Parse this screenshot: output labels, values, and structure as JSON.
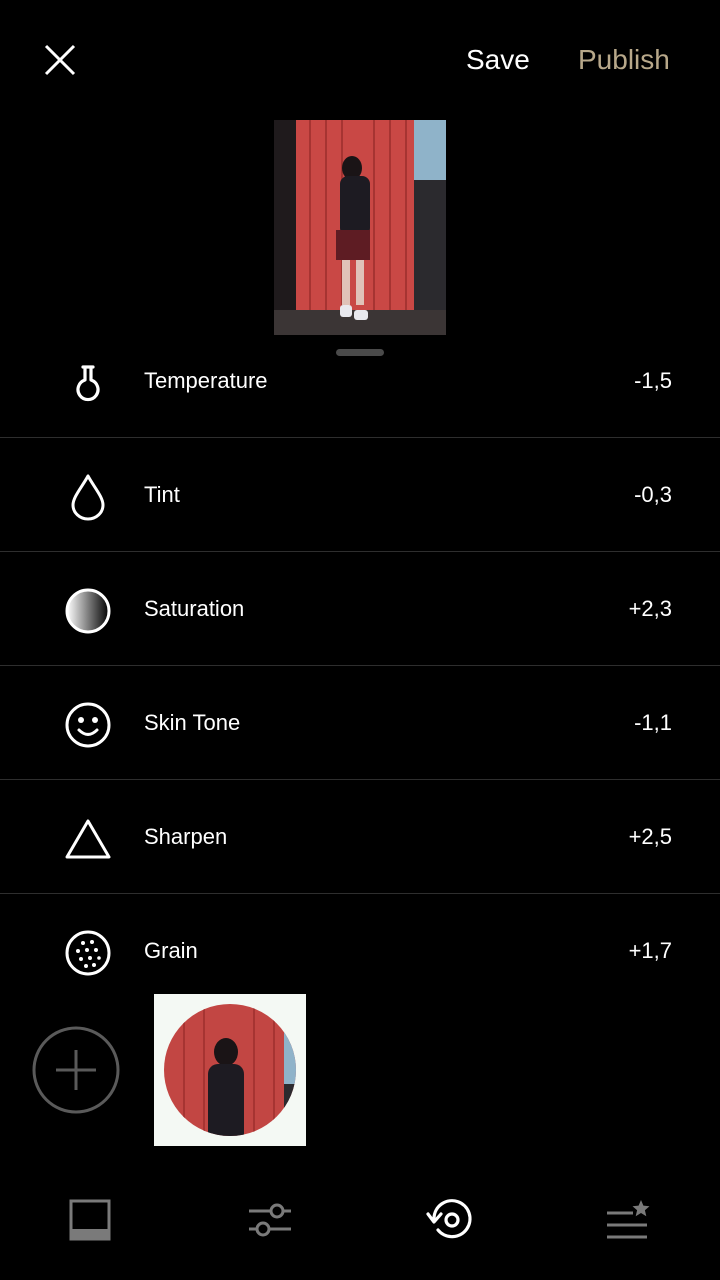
{
  "header": {
    "save_label": "Save",
    "publish_label": "Publish",
    "close_icon": "close-icon"
  },
  "colors": {
    "background": "#000000",
    "publish": "#b8a88a",
    "divider": "#2e2e2e",
    "text": "#ffffff"
  },
  "adjustments": [
    {
      "label": "Temperature",
      "value": "-1,5",
      "icon": "thermometer-icon"
    },
    {
      "label": "Tint",
      "value": "-0,3",
      "icon": "droplet-icon"
    },
    {
      "label": "Saturation",
      "value": "+2,3",
      "icon": "saturation-icon"
    },
    {
      "label": "Skin Tone",
      "value": "-1,1",
      "icon": "smiley-icon"
    },
    {
      "label": "Sharpen",
      "value": "+2,5",
      "icon": "triangle-icon"
    },
    {
      "label": "Grain",
      "value": "+1,7",
      "icon": "grain-icon"
    }
  ],
  "bottom_nav": [
    {
      "name": "frame-icon"
    },
    {
      "name": "sliders-icon"
    },
    {
      "name": "history-icon",
      "active": true
    },
    {
      "name": "recipes-icon"
    }
  ]
}
